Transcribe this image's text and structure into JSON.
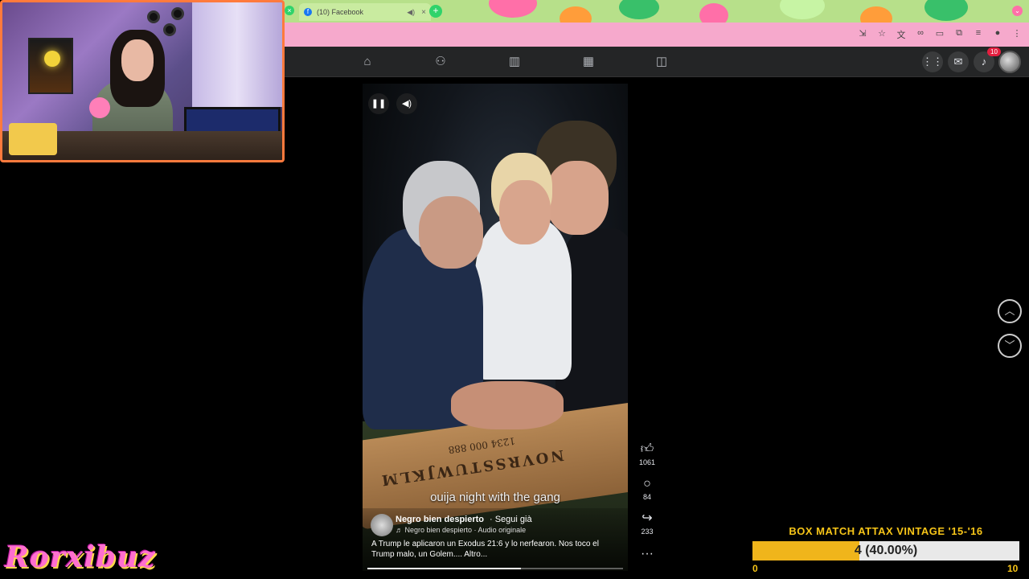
{
  "browser": {
    "tab_title": "(10) Facebook",
    "tab_close": "×",
    "new_tab": "+"
  },
  "fb_nav": {
    "notifications_count": "10"
  },
  "video": {
    "caption": "ouija night with the gang",
    "author": "Negro bien despierto",
    "follow": "· Segui già",
    "audio": "♬ Negro bien despierto · Audio originale",
    "description": "A Trump le aplicaron un Exodus 21:6 y lo nerfearon. Nos toco el Trump malo, un Golem.... Altro...",
    "board_letters": "NOVRSSTUWJKLM",
    "board_numbers": "1234 000 888",
    "progress_fraction": 0.6
  },
  "reactions": {
    "likes": "1061",
    "comments": "84",
    "shares": "233",
    "more": "···"
  },
  "overlay": {
    "title": "BOX MATCH ATTAX VINTAGE '15-'16",
    "current": "4",
    "percent": "(40.00%)",
    "min": "0",
    "max": "10",
    "fraction": 0.4
  },
  "streamer": {
    "brand": "Rorxibuz"
  },
  "colors": {
    "tabstrip": "#b7e08a",
    "addressbar": "#f6a9cc",
    "fb_nav_bg": "#242526",
    "overlay_accent": "#f7c518",
    "brand_pink": "#ff6fd0"
  }
}
